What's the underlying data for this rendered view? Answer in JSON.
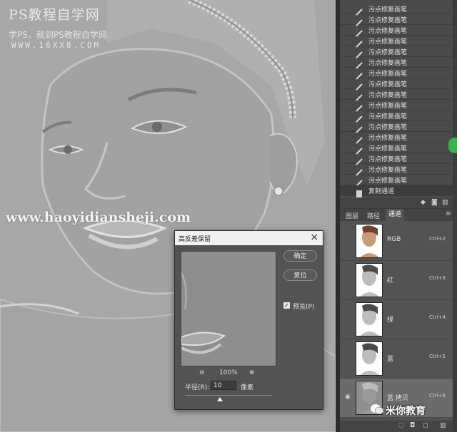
{
  "watermark": {
    "logo": "PS教程自学网",
    "subtitle": "学PS，就到PS教程自学网",
    "url": "WWW.16XX8.COM",
    "site": "www.haoyidiansheji.com"
  },
  "history": {
    "items": [
      {
        "label": "污点修复画笔"
      },
      {
        "label": "污点修复画笔"
      },
      {
        "label": "污点修复画笔"
      },
      {
        "label": "污点修复画笔"
      },
      {
        "label": "污点修复画笔"
      },
      {
        "label": "污点修复画笔"
      },
      {
        "label": "污点修复画笔"
      },
      {
        "label": "污点修复画笔"
      },
      {
        "label": "污点修复画笔"
      },
      {
        "label": "污点修复画笔"
      },
      {
        "label": "污点修复画笔"
      },
      {
        "label": "污点修复画笔"
      },
      {
        "label": "污点修复画笔"
      },
      {
        "label": "污点修复画笔"
      },
      {
        "label": "污点修复画笔"
      },
      {
        "label": "污点修复画笔"
      },
      {
        "label": "污点修复画笔"
      }
    ],
    "last": {
      "label": "复制通道"
    }
  },
  "channels": {
    "tabs": [
      "图层",
      "路径",
      "通道"
    ],
    "active_tab": "通道",
    "rows": [
      {
        "name": "RGB",
        "shortcut": "Ctrl+2"
      },
      {
        "name": "红",
        "shortcut": "Ctrl+3"
      },
      {
        "name": "绿",
        "shortcut": "Ctrl+4"
      },
      {
        "name": "蓝",
        "shortcut": "Ctrl+5"
      },
      {
        "name": "蓝 拷贝",
        "shortcut": "Ctrl+6"
      }
    ]
  },
  "dialog": {
    "title": "高反差保留",
    "ok": "确定",
    "reset": "复位",
    "preview_label": "预览(P)",
    "zoom": "100%",
    "radius_label": "半径(R):",
    "radius_value": "10",
    "unit": "像素",
    "radius_slider_fraction": 0.4
  },
  "brand": "米你教育",
  "colors": {
    "accent_green": "#37b24d",
    "panel": "#535353"
  }
}
